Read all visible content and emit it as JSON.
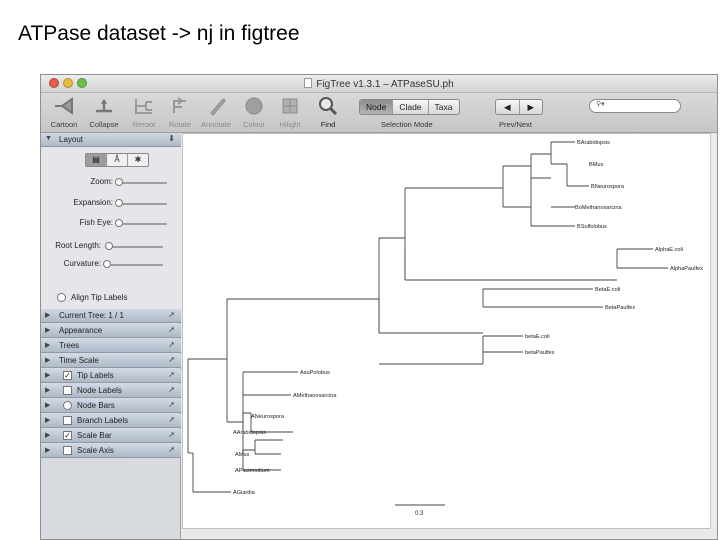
{
  "slide": {
    "title": "ATPase dataset -> nj in figtree"
  },
  "window": {
    "title": "FigTree v1.3.1 – ATPaseSU.ph"
  },
  "toolbar": {
    "tools": [
      {
        "label": "Cartoon",
        "icon": "cartoon-icon"
      },
      {
        "label": "Collapse",
        "icon": "collapse-icon"
      },
      {
        "label": "Reroot",
        "icon": "reroot-icon"
      },
      {
        "label": "Rotate",
        "icon": "rotate-icon"
      },
      {
        "label": "Annotate",
        "icon": "annotate-icon"
      },
      {
        "label": "Colour",
        "icon": "colour-icon"
      },
      {
        "label": "Hilight",
        "icon": "hilight-icon"
      },
      {
        "label": "Find",
        "icon": "find-icon"
      }
    ],
    "selection_mode": {
      "label": "Selection Mode",
      "options": [
        "Node",
        "Clade",
        "Taxa"
      ],
      "active": "Node"
    },
    "prev_next": {
      "label": "Prev/Next"
    }
  },
  "sidebar": {
    "layout": {
      "title": "Layout",
      "zoom_label": "Zoom:",
      "expansion_label": "Expansion:",
      "fisheye_label": "Fish Eye:",
      "root_length_label": "Root Length:",
      "curvature_label": "Curvature:",
      "align_tip_labels": "Align Tip Labels",
      "zoom": 0.0,
      "expansion": 0.0,
      "fisheye": 0.0,
      "root_length": 0.02,
      "curvature": 0.0
    },
    "panels": [
      {
        "label": "Current Tree: 1 / 1",
        "checkbox": false
      },
      {
        "label": "Appearance",
        "checkbox": false
      },
      {
        "label": "Trees",
        "checkbox": false
      },
      {
        "label": "Time Scale",
        "checkbox": false
      },
      {
        "label": "Tip Labels",
        "checkbox": true,
        "checked": true
      },
      {
        "label": "Node Labels",
        "checkbox": true,
        "checked": false
      },
      {
        "label": "Node Bars",
        "checkbox": true,
        "checked": false
      },
      {
        "label": "Branch Labels",
        "checkbox": true,
        "checked": false
      },
      {
        "label": "Scale Bar",
        "checkbox": true,
        "checked": true
      },
      {
        "label": "Scale Axis",
        "checkbox": true,
        "checked": false
      }
    ]
  },
  "tree": {
    "leaves": [
      "BArabidopsis",
      "BMus",
      "BNeurospora",
      "BoMethanosarcina",
      "BSulfolobus",
      "AlphaE.coli",
      "AlphaPaulfex",
      "BetaE.coli",
      "BetaPaulfex",
      "betaE.coli",
      "betaPaulfex",
      "AsuPolobus",
      "AMethanosarcina",
      "ANeurospora",
      "AArabidopsis",
      "AMus",
      "APlasmodium",
      "AGiardia"
    ],
    "scale_bar": "0.3"
  },
  "colors": {
    "window_bg": "#e9e9e9",
    "sidebar_bg": "#d7dbe0",
    "panel_head": "#aeb9c7",
    "tree_line": "#444444"
  }
}
